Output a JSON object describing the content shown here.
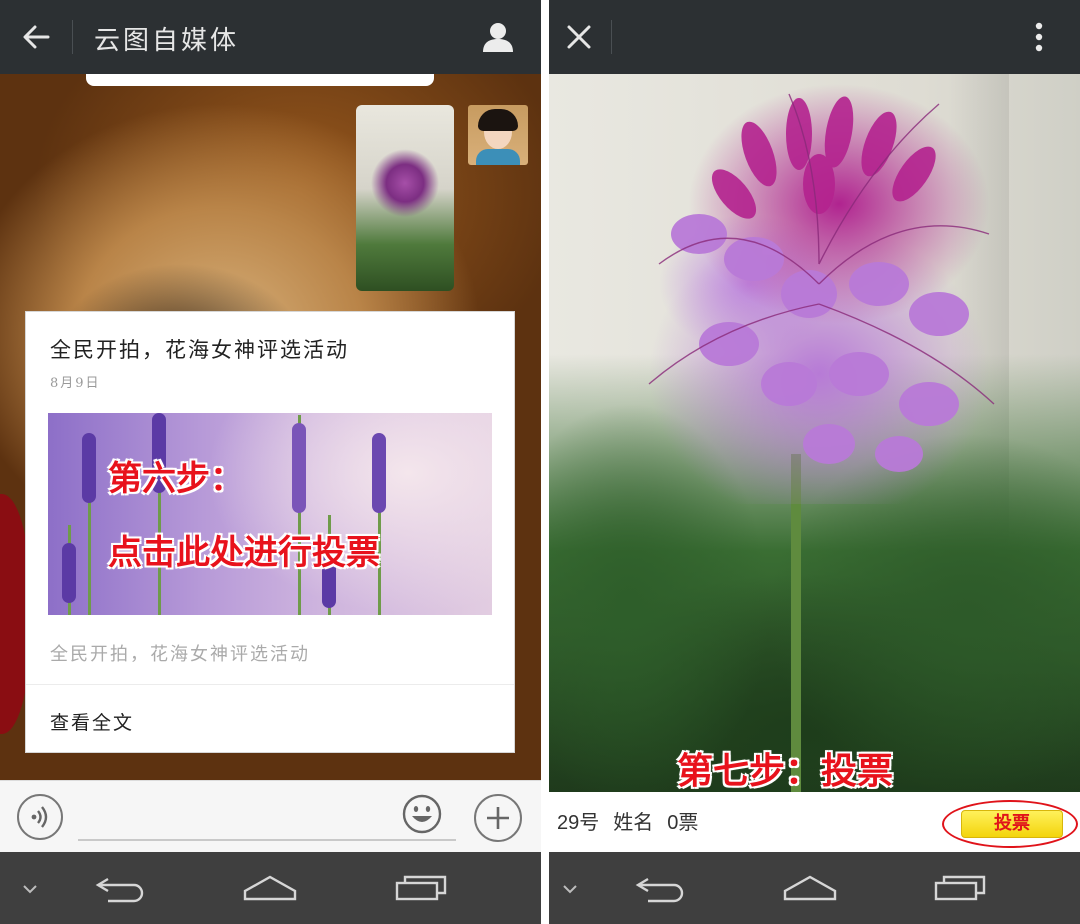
{
  "left_screen": {
    "header": {
      "title": "云图自媒体",
      "back_icon": "arrow-left-icon",
      "profile_icon": "person-icon"
    },
    "article": {
      "title": "全民开拍，花海女神评选活动",
      "date": "8月9日",
      "cover_caption_line1": "第六步：",
      "cover_caption_line2": "点击此处进行投票",
      "description": "全民开拍，花海女神评选活动",
      "read_more": "查看全文"
    },
    "input_bar": {
      "voice_icon": "voice-icon",
      "emoji_icon": "emoji-icon",
      "plus_icon": "plus-icon"
    }
  },
  "right_screen": {
    "header": {
      "close_icon": "close-icon",
      "more_icon": "more-vertical-icon"
    },
    "photo_caption": "第七步：投票",
    "entry": {
      "number": "29号",
      "name": "姓名",
      "votes": "0票"
    },
    "vote_button": "投票"
  },
  "nav_icons": [
    "chevron-down-icon",
    "back-icon",
    "home-icon",
    "recents-icon"
  ],
  "colors": {
    "topbar": "#2c3033",
    "navbar": "#3f3f3f",
    "caption_red": "#e8121c",
    "vote_yellow": "#f3d40c"
  }
}
